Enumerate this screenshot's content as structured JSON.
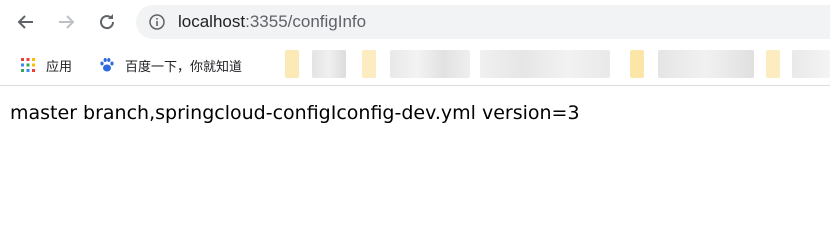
{
  "browser": {
    "url_host": "localhost",
    "url_rest": ":3355/configInfo"
  },
  "bookmarks": {
    "apps_label": "应用",
    "baidu_label": "百度一下，你就知道"
  },
  "page": {
    "content_text": "master branch,springcloud-configIconfig-dev.yml version=3"
  },
  "colors": {
    "omnibox_bg": "#f1f3f4",
    "icon_gray": "#5f6368",
    "forward_disabled": "#bdc1c6"
  }
}
